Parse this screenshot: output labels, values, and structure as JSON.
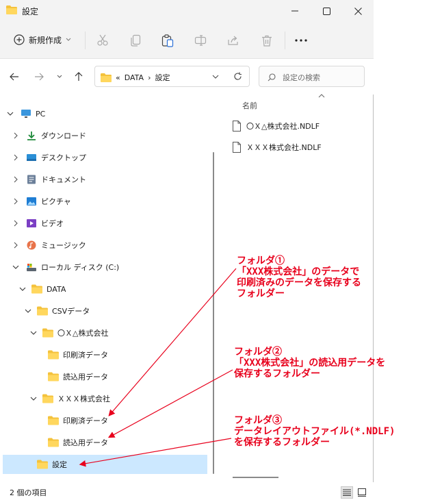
{
  "window": {
    "title": "設定"
  },
  "toolbar": {
    "new_label": "新規作成"
  },
  "address": {
    "prefix": "«",
    "crumb1": "DATA",
    "sep": "›",
    "crumb2": "設定"
  },
  "search": {
    "placeholder": "設定の検索"
  },
  "tree": {
    "pc": "PC",
    "downloads": "ダウンロード",
    "desktop": "デスクトップ",
    "documents": "ドキュメント",
    "pictures": "ピクチャ",
    "videos": "ビデオ",
    "music": "ミュージック",
    "localdisk": "ローカル ディスク (C:)",
    "data": "DATA",
    "csv": "CSVデータ",
    "company1": "〇Ｘ△株式会社",
    "c1_printed": "印刷済データ",
    "c1_read": "読込用データ",
    "company2": "ＸＸＸ株式会社",
    "c2_printed": "印刷済データ",
    "c2_read": "読込用データ",
    "settings": "設定"
  },
  "filelist": {
    "column_name": "名前",
    "files": [
      "〇Ｘ△株式会社.NDLF",
      "ＸＸＸ株式会社.NDLF"
    ]
  },
  "status": {
    "count": "2 個の項目"
  },
  "annotations": {
    "a1": [
      "フォルダ①",
      "「XXX株式会社」のデータで",
      "印刷済みのデータを保存する",
      "フォルダー"
    ],
    "a2": [
      "フォルダ②",
      "「XXX株式会社」の読込用データを",
      "保存するフォルダー"
    ],
    "a3": [
      "フォルダ③",
      "データレイアウトファイル(*.NDLF)",
      "を保存するフォルダー"
    ]
  },
  "colors": {
    "accent": "#cce8ff",
    "annotation": "#e8001c",
    "folder": "#f4c23c"
  }
}
